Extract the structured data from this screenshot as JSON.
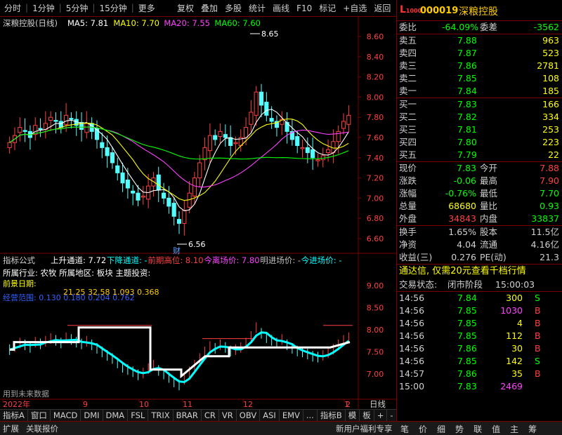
{
  "toolbar": {
    "left": [
      "分时",
      "1分钟",
      "5分钟",
      "15分钟",
      "更多"
    ],
    "right": [
      "复权",
      "叠加",
      "多股",
      "统计",
      "画线",
      "F10",
      "标记",
      "+自选",
      "返回"
    ]
  },
  "chart": {
    "title": "深粮控股(日线)",
    "ma": [
      {
        "label": "MA5: 7.81",
        "color": "#ffffff"
      },
      {
        "label": "MA10: 7.70",
        "color": "#ffff00"
      },
      {
        "label": "MA20: 7.55",
        "color": "#ff40ff"
      },
      {
        "label": "MA60: 7.60",
        "color": "#00ff00"
      }
    ],
    "price_axis": [
      "8.60",
      "8.40",
      "8.20",
      "8.00",
      "7.80",
      "7.60",
      "7.40",
      "7.20",
      "7.00",
      "6.80",
      "6.60"
    ],
    "high_label": "8.65",
    "low_label": "6.56",
    "fin_marker": "财",
    "indicator_axis": [
      "9.00",
      "8.50",
      "8.00",
      "7.50",
      "7.00"
    ],
    "x_labels": [
      "2022年",
      "9",
      "10",
      "11",
      "12",
      "1",
      "2"
    ],
    "x_axis_caption": "日线",
    "future_data_note": "用到未来数据"
  },
  "indicator": {
    "name": "指标公式",
    "items": [
      {
        "label": "上升通道: 7.72",
        "color": "#ffffff"
      },
      {
        "label": "下降通道: -",
        "color": "#00ffff"
      },
      {
        "label": "前期高位: 8.10",
        "color": "#ff4040"
      },
      {
        "label": "今离场价: 7.80",
        "color": "#ff40ff"
      },
      {
        "label": "明进场价: -",
        "color": "#c0c0c0"
      },
      {
        "label": "今进场价: -",
        "color": "#00ffff"
      }
    ],
    "overlay_line1": "所属行业: 农牧 所属地区: 板块 主题投资:",
    "overlay_line2": "前景日期:",
    "overlay_line3": "经营范围: 0.130 0.180 0.204 0.762",
    "overlay_line4": "21.25 32.58 1.093 0.368"
  },
  "tabs": [
    "指标A",
    "窗口",
    "MACD",
    "DMI",
    "DMA",
    "FSL",
    "TRIX",
    "BRAR",
    "CR",
    "VR",
    "OBV",
    "ASI",
    "EMV",
    "...",
    "指标B",
    "模",
    "板",
    "+",
    "-"
  ],
  "quote": {
    "mark": "L",
    "mark_sub": "1000",
    "code": "000019",
    "name": "深粮控股",
    "weibi_label": "委比",
    "weibi": "-64.09%",
    "weicha_label": "委差",
    "weicha": "-3562",
    "asks": [
      {
        "label": "卖五",
        "price": "7.88",
        "vol": "963"
      },
      {
        "label": "卖四",
        "price": "7.87",
        "vol": "523"
      },
      {
        "label": "卖三",
        "price": "7.86",
        "vol": "2781"
      },
      {
        "label": "卖二",
        "price": "7.85",
        "vol": "108"
      },
      {
        "label": "卖一",
        "price": "7.84",
        "vol": "185"
      }
    ],
    "bids": [
      {
        "label": "买一",
        "price": "7.83",
        "vol": "166"
      },
      {
        "label": "买二",
        "price": "7.82",
        "vol": "334"
      },
      {
        "label": "买三",
        "price": "7.81",
        "vol": "253"
      },
      {
        "label": "买四",
        "price": "7.80",
        "vol": "223"
      },
      {
        "label": "买五",
        "price": "7.79",
        "vol": "22"
      }
    ],
    "stats": [
      {
        "l1": "现价",
        "v1": "7.83",
        "c1": "#00ff00",
        "l2": "今开",
        "v2": "7.88",
        "c2": "#ff4040"
      },
      {
        "l1": "涨跌",
        "v1": "-0.06",
        "c1": "#00ff00",
        "l2": "最高",
        "v2": "7.90",
        "c2": "#ff4040"
      },
      {
        "l1": "涨幅",
        "v1": "-0.76%",
        "c1": "#00ff00",
        "l2": "最低",
        "v2": "7.70",
        "c2": "#00ff00"
      },
      {
        "l1": "总量",
        "v1": "68680",
        "c1": "#ffff00",
        "l2": "量比",
        "v2": "0.93",
        "c2": "#00ff00"
      },
      {
        "l1": "外盘",
        "v1": "34843",
        "c1": "#ff4040",
        "l2": "内盘",
        "v2": "33837",
        "c2": "#00ff00"
      }
    ],
    "fund": [
      {
        "l1": "换手",
        "v1": "1.65%",
        "l2": "股本",
        "v2": "11.5亿"
      },
      {
        "l1": "净资",
        "v1": "4.04",
        "l2": "流通",
        "v2": "4.16亿"
      },
      {
        "l1": "收益(三)",
        "v1": "0.276",
        "l2": "PE(动)",
        "v2": "21.3"
      }
    ],
    "promo": "通达信, 仅需20元查看千档行情",
    "trade_status_label": "交易状态:",
    "trade_status": "闭市阶段",
    "trade_time": "15:00:03",
    "ticks": [
      {
        "t": "14:56",
        "p": "7.84",
        "pc": "#00ff00",
        "v": "300",
        "vc": "#ffff00",
        "s": "S",
        "sc": "#00ff00"
      },
      {
        "t": "14:56",
        "p": "7.85",
        "pc": "#00ff00",
        "v": "1030",
        "vc": "#ff40ff",
        "s": "B",
        "sc": "#ff4040"
      },
      {
        "t": "14:56",
        "p": "7.85",
        "pc": "#00ff00",
        "v": "4",
        "vc": "#ffff00",
        "s": "B",
        "sc": "#ff4040"
      },
      {
        "t": "14:56",
        "p": "7.85",
        "pc": "#00ff00",
        "v": "112",
        "vc": "#ffff00",
        "s": "B",
        "sc": "#ff4040"
      },
      {
        "t": "14:56",
        "p": "7.86",
        "pc": "#00ff00",
        "v": "30",
        "vc": "#ffff00",
        "s": "B",
        "sc": "#ff4040"
      },
      {
        "t": "14:56",
        "p": "7.85",
        "pc": "#00ff00",
        "v": "142",
        "vc": "#ffff00",
        "s": "S",
        "sc": "#00ff00"
      },
      {
        "t": "14:57",
        "p": "7.86",
        "pc": "#00ff00",
        "v": "35",
        "vc": "#ffff00",
        "s": "B",
        "sc": "#ff4040"
      },
      {
        "t": "15:00",
        "p": "7.83",
        "pc": "#00ff00",
        "v": "2469",
        "vc": "#ff40ff",
        "s": "",
        "sc": "#ffffff"
      }
    ]
  },
  "bottom": {
    "left": [
      "扩展",
      "关联报价"
    ],
    "mid": "新用户福利专享",
    "icons": [
      "笔",
      "价",
      "细",
      "势",
      "联",
      "值",
      "主",
      "筹"
    ]
  },
  "colors": {
    "up": "#ff4040",
    "down": "#00ff00",
    "border": "#7a0000"
  }
}
